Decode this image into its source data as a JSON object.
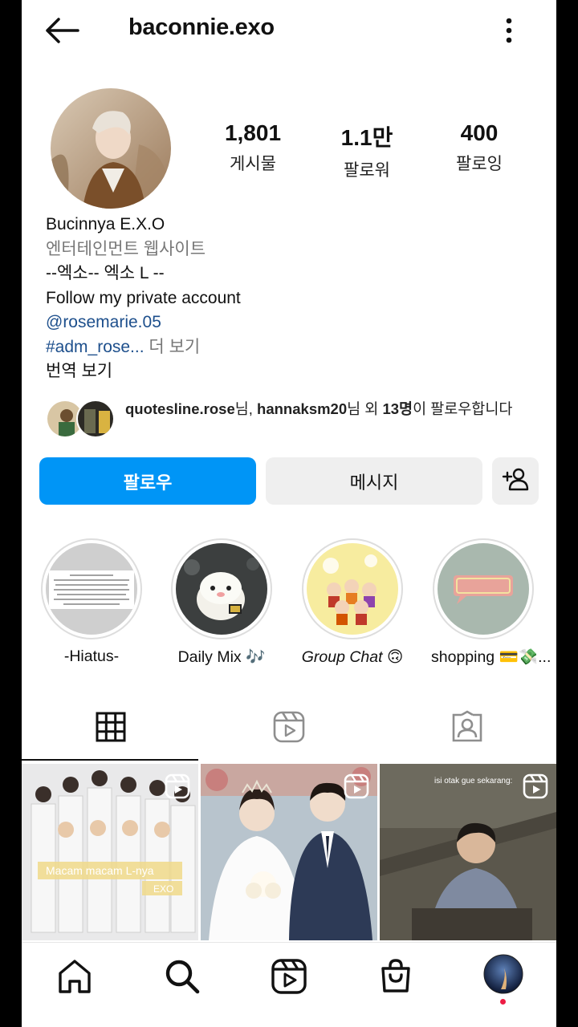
{
  "header": {
    "username": "baconnie.exo"
  },
  "stats": [
    {
      "count": "1,801",
      "label": "게시물"
    },
    {
      "count": "1.1만",
      "label": "팔로워"
    },
    {
      "count": "400",
      "label": "팔로잉"
    }
  ],
  "bio": {
    "name": "Bucinnya E.X.O",
    "category": "엔터테인먼트 웹사이트",
    "line1": "--엑소-- 엑소 L --",
    "line2": "Follow my private account",
    "mention": "@rosemarie.05",
    "hashtag": "#adm_rose...",
    "more": " 더 보기",
    "translate": "번역 보기"
  },
  "mutual": {
    "user1": "quotesline.rose",
    "suffix1": "님, ",
    "user2": "hannaksm20",
    "suffix2": "님 외 ",
    "count": "13명",
    "suffix3": "이 팔로우합니다"
  },
  "actions": {
    "follow": "팔로우",
    "message": "메시지"
  },
  "highlights": [
    {
      "label": "-Hiatus-"
    },
    {
      "label": "Daily Mix 🎶"
    },
    {
      "label": "Group Chat 🙃"
    },
    {
      "label": "shopping 💳💸..."
    }
  ],
  "posts": [
    {
      "overlay_text": "Macam macam L-nya",
      "overlay_sub": "EXO"
    },
    {
      "overlay_text": ""
    },
    {
      "overlay_text": "isi otak gue sekarang:"
    }
  ],
  "colors": {
    "accent": "#0095f6",
    "link": "#1d4f8c",
    "notification": "#ed1c44"
  }
}
